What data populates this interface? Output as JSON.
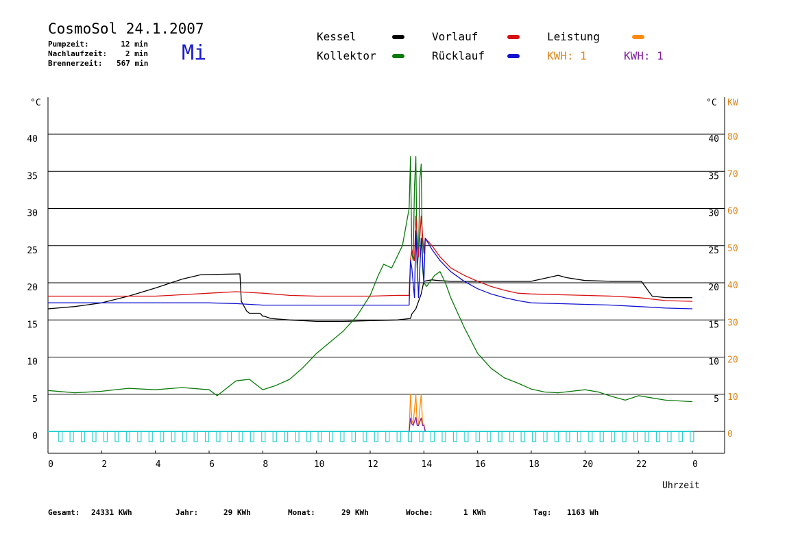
{
  "header": {
    "title": "CosmoSol 24.1.2007",
    "weekday": "Mi",
    "rows": [
      {
        "label": "Pumpzeit:",
        "value": "12 min"
      },
      {
        "label": "Nachlaufzeit:",
        "value": "2 min"
      },
      {
        "label": "Brennerzeit:",
        "value": "567 min"
      }
    ]
  },
  "legend": {
    "kessel": "Kessel",
    "kollektor": "Kollektor",
    "vorlauf": "Vorlauf",
    "ruecklauf": "Rücklauf",
    "leistung": "Leistung",
    "kwh1": "KWH: 1",
    "kwh2": "KWH: 1"
  },
  "axes": {
    "left_unit": "°C",
    "right_unit": "°C",
    "right_unit2": "KW",
    "xlabel": "Uhrzeit"
  },
  "colors": {
    "kessel": "#000000",
    "kollektor": "#0a7a0a",
    "vorlauf": "#d81010",
    "ruecklauf": "#1010d0",
    "leistung": "#ff8c10",
    "kwh2": "#8020a0",
    "pump": "#30d0d0",
    "day": "#1a1ad0"
  },
  "footer": {
    "gesamt_label": "Gesamt:",
    "gesamt_value": "24331 KWh",
    "jahr_label": "Jahr:",
    "jahr_value": "29 KWh",
    "monat_label": "Monat:",
    "monat_value": "29 KWh",
    "woche_label": "Woche:",
    "woche_value": "1 KWh",
    "tag_label": "Tag:",
    "tag_value": "1163 Wh"
  },
  "chart_data": {
    "type": "line",
    "xlabel": "Uhrzeit",
    "ylabel": "°C",
    "y2label": "KW",
    "xlim": [
      0,
      24
    ],
    "ylim": [
      0,
      45
    ],
    "x_ticks": [
      "0",
      "2",
      "4",
      "6",
      "8",
      "10",
      "12",
      "14",
      "16",
      "18",
      "20",
      "22",
      "0"
    ],
    "y_ticks_left": [
      "0",
      "5",
      "10",
      "15",
      "20",
      "25",
      "30",
      "35",
      "40"
    ],
    "y_ticks_right": [
      "5",
      "10",
      "15",
      "20",
      "25",
      "30",
      "35",
      "40"
    ],
    "y2_ticks": [
      "0",
      "10",
      "20",
      "30",
      "40",
      "50",
      "60",
      "70",
      "80"
    ],
    "grid": true,
    "series": [
      {
        "name": "Kessel",
        "key": "kessel",
        "x": [
          0,
          1,
          2,
          3,
          4,
          5,
          5.7,
          7.15,
          7.2,
          7.4,
          7.5,
          7.9,
          8,
          8.05,
          8.3,
          9,
          9.5,
          10,
          11,
          12,
          13,
          13.5,
          13.55,
          13.7,
          13.9,
          14,
          14.3,
          14.5,
          15,
          15.5,
          16,
          17,
          18,
          18.5,
          19,
          19.3,
          20,
          21,
          22,
          22.1,
          22.5,
          23,
          24
        ],
        "y": [
          16.5,
          16.8,
          17.3,
          18.2,
          19.3,
          20.5,
          21.1,
          21.2,
          17.5,
          16.2,
          15.9,
          15.9,
          15.5,
          15.5,
          15.2,
          15.0,
          14.9,
          14.8,
          14.8,
          14.9,
          15.0,
          15.2,
          15.8,
          16.5,
          18.5,
          20.2,
          20.4,
          20.3,
          20.2,
          20.2,
          20.2,
          20.2,
          20.2,
          20.6,
          21.0,
          20.7,
          20.3,
          20.2,
          20.2,
          20.2,
          18.2,
          18.0,
          18.0
        ]
      },
      {
        "name": "Kollektor",
        "key": "kollektor",
        "x": [
          0,
          1,
          2,
          3,
          4,
          5,
          6,
          6.3,
          7,
          7.5,
          8,
          8.5,
          9,
          9.5,
          10,
          10.5,
          11,
          11.5,
          12,
          12.3,
          12.5,
          12.8,
          13.2,
          13.45,
          13.5,
          13.55,
          13.6,
          13.65,
          13.7,
          13.75,
          13.8,
          13.85,
          13.9,
          13.95,
          14,
          14.1,
          14.2,
          14.4,
          14.6,
          14.8,
          15,
          15.5,
          16,
          16.5,
          17,
          17.5,
          18,
          18.5,
          19,
          19.5,
          20,
          20.5,
          21,
          21.5,
          22,
          22.5,
          23,
          24
        ],
        "y": [
          5.5,
          5.2,
          5.4,
          5.8,
          5.6,
          5.9,
          5.6,
          4.8,
          6.8,
          7.0,
          5.6,
          6.2,
          7.0,
          8.6,
          10.5,
          12.0,
          13.5,
          15.5,
          18.3,
          21.0,
          22.5,
          22.0,
          25.0,
          30.0,
          37.0,
          24.0,
          23.0,
          33.0,
          37.0,
          22.0,
          24.0,
          34.0,
          36.0,
          22.0,
          20.0,
          19.5,
          20.0,
          21.0,
          21.5,
          20.0,
          18.0,
          14.0,
          10.5,
          8.5,
          7.2,
          6.5,
          5.7,
          5.3,
          5.2,
          5.4,
          5.6,
          5.3,
          4.7,
          4.2,
          4.8,
          4.5,
          4.2,
          4.0
        ]
      },
      {
        "name": "Vorlauf",
        "key": "vorlauf",
        "x": [
          0,
          2,
          4,
          5,
          6,
          7,
          8,
          9,
          10,
          11,
          12,
          13,
          13.45,
          13.5,
          13.55,
          13.65,
          13.7,
          13.8,
          13.9,
          14,
          14.05,
          14.3,
          14.6,
          15,
          15.5,
          16,
          16.5,
          17,
          17.5,
          18,
          19,
          20,
          21,
          22,
          23,
          24
        ],
        "y": [
          18.2,
          18.2,
          18.2,
          18.4,
          18.6,
          18.8,
          18.6,
          18.3,
          18.2,
          18.2,
          18.2,
          18.3,
          18.3,
          23.0,
          24.5,
          23.0,
          29.0,
          23.5,
          29.0,
          24.0,
          26.0,
          25.0,
          23.5,
          22.0,
          21.0,
          20.2,
          19.5,
          19.0,
          18.6,
          18.5,
          18.4,
          18.3,
          18.2,
          18.0,
          17.6,
          17.5
        ]
      },
      {
        "name": "Rücklauf",
        "key": "ruecklauf",
        "x": [
          0,
          2,
          4,
          5,
          6,
          7,
          8,
          9,
          10,
          11,
          12,
          13,
          13.45,
          13.5,
          13.55,
          13.65,
          13.7,
          13.8,
          13.9,
          14,
          14.05,
          14.3,
          14.6,
          15,
          15.5,
          16,
          16.5,
          17,
          17.5,
          18,
          19,
          20,
          21,
          22,
          23,
          24
        ],
        "y": [
          17.3,
          17.3,
          17.3,
          17.3,
          17.3,
          17.2,
          17.0,
          17.0,
          17.0,
          17.0,
          17.0,
          17.0,
          17.0,
          23.0,
          22.0,
          18.0,
          27.0,
          18.0,
          26.0,
          20.0,
          26.0,
          24.5,
          23.0,
          21.5,
          20.2,
          19.2,
          18.5,
          18.0,
          17.6,
          17.3,
          17.2,
          17.1,
          17.0,
          16.8,
          16.6,
          16.5
        ]
      },
      {
        "name": "Leistung",
        "key": "leistung",
        "x": [
          13.45,
          13.5,
          13.55,
          13.6,
          13.7,
          13.75,
          13.8,
          13.9,
          13.95,
          14,
          14.05
        ],
        "y": [
          0,
          5,
          1.5,
          1,
          5,
          1,
          1,
          5,
          1,
          1,
          0
        ]
      },
      {
        "name": "KWH: 1",
        "key": "kwh2",
        "x": [
          13.45,
          13.5,
          13.55,
          13.6,
          13.7,
          13.75,
          13.8,
          13.9,
          13.95,
          14,
          14.05
        ],
        "y": [
          0,
          1.8,
          1.0,
          0.8,
          1.9,
          0.8,
          0.8,
          1.8,
          0.8,
          0.8,
          0
        ]
      }
    ]
  }
}
